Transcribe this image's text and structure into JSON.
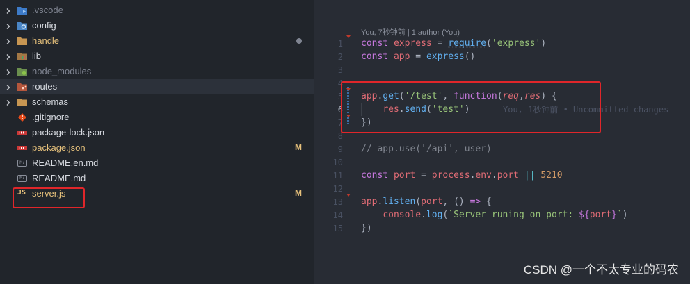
{
  "explorer": {
    "items": [
      {
        "name": ".vscode",
        "type": "folder",
        "icon": "vscode-folder-icon",
        "dim": true,
        "status": ""
      },
      {
        "name": "config",
        "type": "folder",
        "icon": "config-folder-icon",
        "dim": false,
        "status": ""
      },
      {
        "name": "handle",
        "type": "folder",
        "icon": "folder-icon",
        "dim": false,
        "status": "dot",
        "modified": true
      },
      {
        "name": "lib",
        "type": "folder",
        "icon": "lib-folder-icon",
        "dim": false,
        "status": ""
      },
      {
        "name": "node_modules",
        "type": "folder",
        "icon": "node-modules-folder-icon",
        "dim": true,
        "status": ""
      },
      {
        "name": "routes",
        "type": "folder",
        "icon": "routes-folder-icon",
        "dim": false,
        "status": "",
        "selected": true
      },
      {
        "name": "schemas",
        "type": "folder",
        "icon": "folder-icon",
        "dim": false,
        "status": ""
      },
      {
        "name": ".gitignore",
        "type": "file",
        "icon": "git-icon",
        "dim": false,
        "status": ""
      },
      {
        "name": "package-lock.json",
        "type": "file",
        "icon": "npm-icon",
        "dim": false,
        "status": ""
      },
      {
        "name": "package.json",
        "type": "file",
        "icon": "npm-icon",
        "dim": false,
        "status": "M",
        "modified": true
      },
      {
        "name": "README.en.md",
        "type": "file",
        "icon": "markdown-icon",
        "dim": false,
        "status": ""
      },
      {
        "name": "README.md",
        "type": "file",
        "icon": "markdown-icon",
        "dim": false,
        "status": ""
      },
      {
        "name": "server.js",
        "type": "file",
        "icon": "js-icon",
        "dim": false,
        "status": "M",
        "modified": true
      }
    ],
    "js_icon_text": "JS",
    "md_icon_text": "M↓"
  },
  "editor": {
    "codelens": "You, 7秒钟前 | 1 author (You)",
    "line_numbers": [
      "1",
      "2",
      "3",
      "4",
      "5",
      "6",
      "7",
      "8",
      "9",
      "10",
      "11",
      "12",
      "13",
      "14",
      "15"
    ],
    "active_line": "6",
    "blame": "You, 1秒钟前 • Uncommitted changes",
    "code": {
      "l1": [
        "const",
        " ",
        "express",
        " = ",
        "require",
        "(",
        "'express'",
        ")"
      ],
      "l2": [
        "const",
        " ",
        "app",
        " = ",
        "express",
        "()"
      ],
      "l5": [
        "app",
        ".",
        "get",
        "(",
        "'/test'",
        ", ",
        "function",
        "(",
        "req",
        ",",
        "res",
        ") {"
      ],
      "l6": [
        "    ",
        "res",
        ".",
        "send",
        "(",
        "'test'",
        ")"
      ],
      "l7": [
        "})"
      ],
      "l9": [
        "// app.use('/api', user)"
      ],
      "l11": [
        "const",
        " ",
        "port",
        " = ",
        "process",
        ".",
        "env",
        ".",
        "port",
        " ",
        "||",
        " ",
        "5210"
      ],
      "l13": [
        "app",
        ".",
        "listen",
        "(",
        "port",
        ", () ",
        "=>",
        " {"
      ],
      "l14": [
        "    ",
        "console",
        ".",
        "log",
        "(",
        "`Server runing on port: ",
        "${",
        "port",
        "}",
        "`",
        ")"
      ],
      "l15": [
        "})"
      ]
    }
  },
  "watermark": "CSDN @一个不太专业的码农",
  "colors": {
    "sidebar_bg": "#21252b",
    "editor_bg": "#282c34",
    "annotation_red": "#e0262a",
    "modified": "#e5c07b"
  }
}
